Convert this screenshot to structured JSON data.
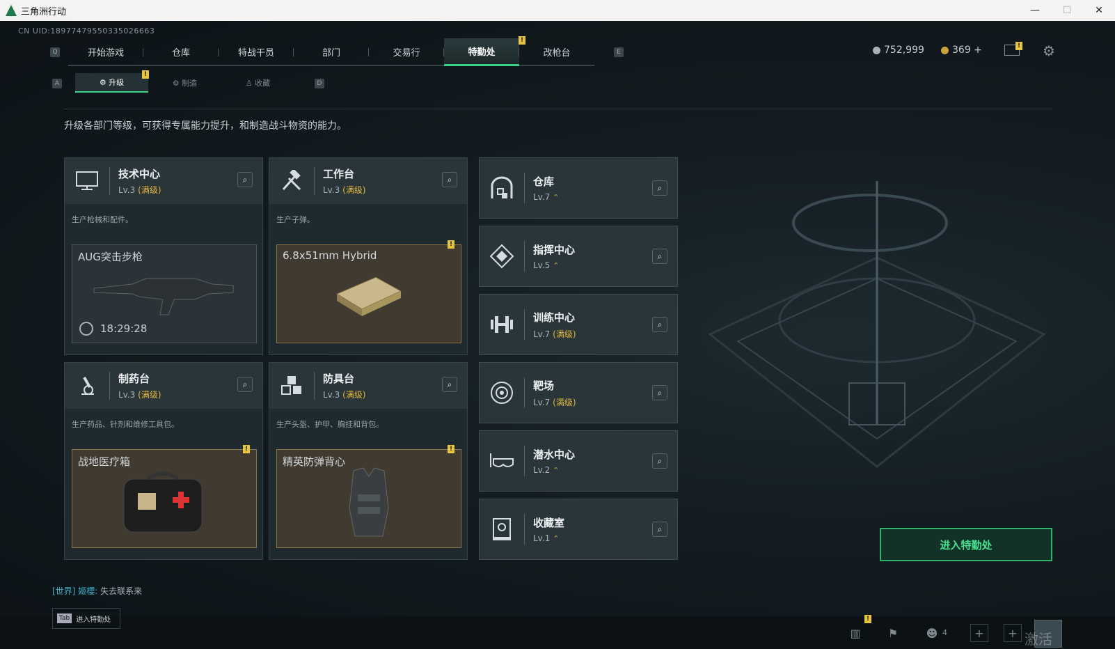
{
  "window": {
    "title": "三角洲行动",
    "min": "—",
    "max": "☐",
    "close": "✕"
  },
  "uid": "CN UID:18977479550335026663",
  "topnav": [
    "开始游戏",
    "仓库",
    "特战干员",
    "部门",
    "交易行",
    "特勤处",
    "改枪台"
  ],
  "currency": {
    "silver": "752,999",
    "gold": "369 +"
  },
  "subnav": [
    "升级",
    "制造",
    "收藏"
  ],
  "intro": "升级各部门等级，可获得专属能力提升，和制造战斗物资的能力。",
  "cards": [
    {
      "title": "技术中心",
      "lv": "Lv.3",
      "max": "(满级)",
      "desc": "生产枪械和配件。",
      "item": "AUG突击步枪",
      "timer": "18:29:28"
    },
    {
      "title": "工作台",
      "lv": "Lv.3",
      "max": "(满级)",
      "desc": "生产子弹。",
      "item": "6.8x51mm Hybrid"
    },
    {
      "title": "制药台",
      "lv": "Lv.3",
      "max": "(满级)",
      "desc": "生产药品、针剂和维修工具包。",
      "item": "战地医疗箱"
    },
    {
      "title": "防具台",
      "lv": "Lv.3",
      "max": "(满级)",
      "desc": "生产头盔、护甲、胸挂和背包。",
      "item": "精英防弹背心"
    }
  ],
  "rooms": [
    {
      "title": "仓库",
      "lv": "Lv.7",
      "extra": "⌃"
    },
    {
      "title": "指挥中心",
      "lv": "Lv.5",
      "extra": "⌃"
    },
    {
      "title": "训练中心",
      "lv": "Lv.7",
      "extra": "(满级)"
    },
    {
      "title": "靶场",
      "lv": "Lv.7",
      "extra": "(满级)"
    },
    {
      "title": "潜水中心",
      "lv": "Lv.2",
      "extra": "⌃"
    },
    {
      "title": "收藏室",
      "lv": "Lv.1",
      "extra": "⌃"
    }
  ],
  "enter_button": "进入特勤处",
  "chat": {
    "channel": "[世界]",
    "user": "姬櫻:",
    "msg": "失去联系来"
  },
  "tabhint": {
    "key": "Tab",
    "label": "进入特勤处"
  },
  "friends_count": "4",
  "watermark": "激活 Windows",
  "keys": {
    "q": "Q",
    "e": "E",
    "a": "A",
    "d": "D"
  },
  "badge": "!"
}
